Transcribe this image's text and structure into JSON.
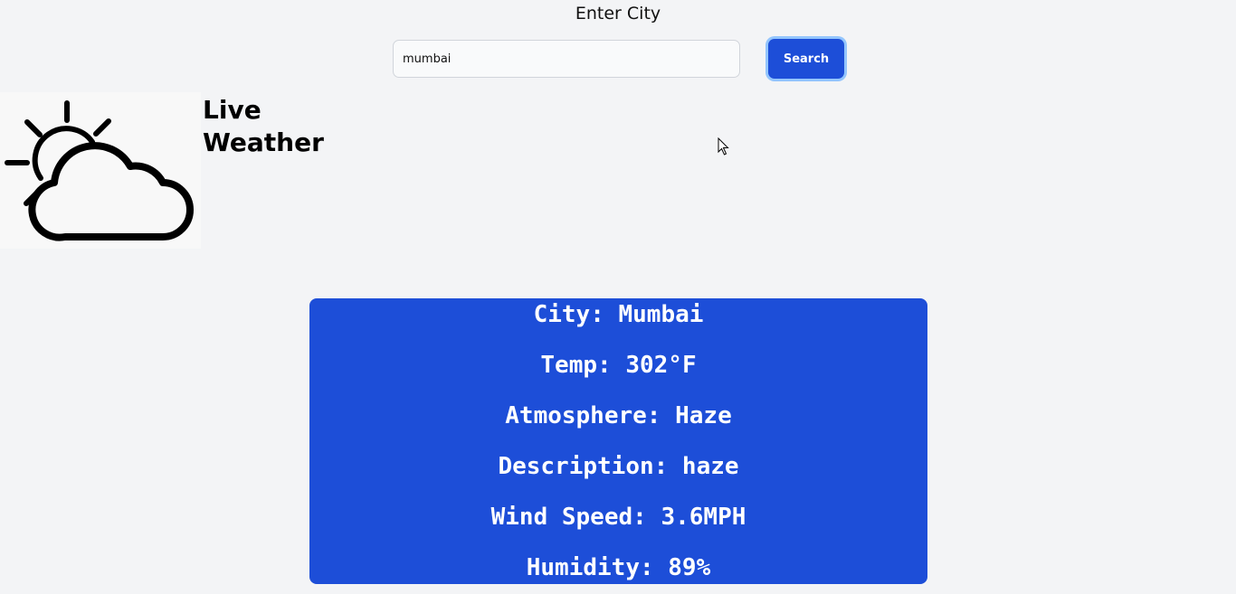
{
  "search": {
    "label": "Enter City",
    "value": "mumbai",
    "button_label": "Search"
  },
  "brand": {
    "title": "Live Weather",
    "logo_icon": "sun-cloud-icon"
  },
  "weather": {
    "city": "City: Mumbai",
    "temp": "Temp: 302°F",
    "atmosphere": "Atmosphere: Haze",
    "description": "Description: haze",
    "wind_speed": "Wind Speed: 3.6MPH",
    "humidity": "Humidity: 89%"
  },
  "colors": {
    "background": "#f3f4f6",
    "accent": "#1d4ed8",
    "focus_ring": "#93c5fd"
  }
}
